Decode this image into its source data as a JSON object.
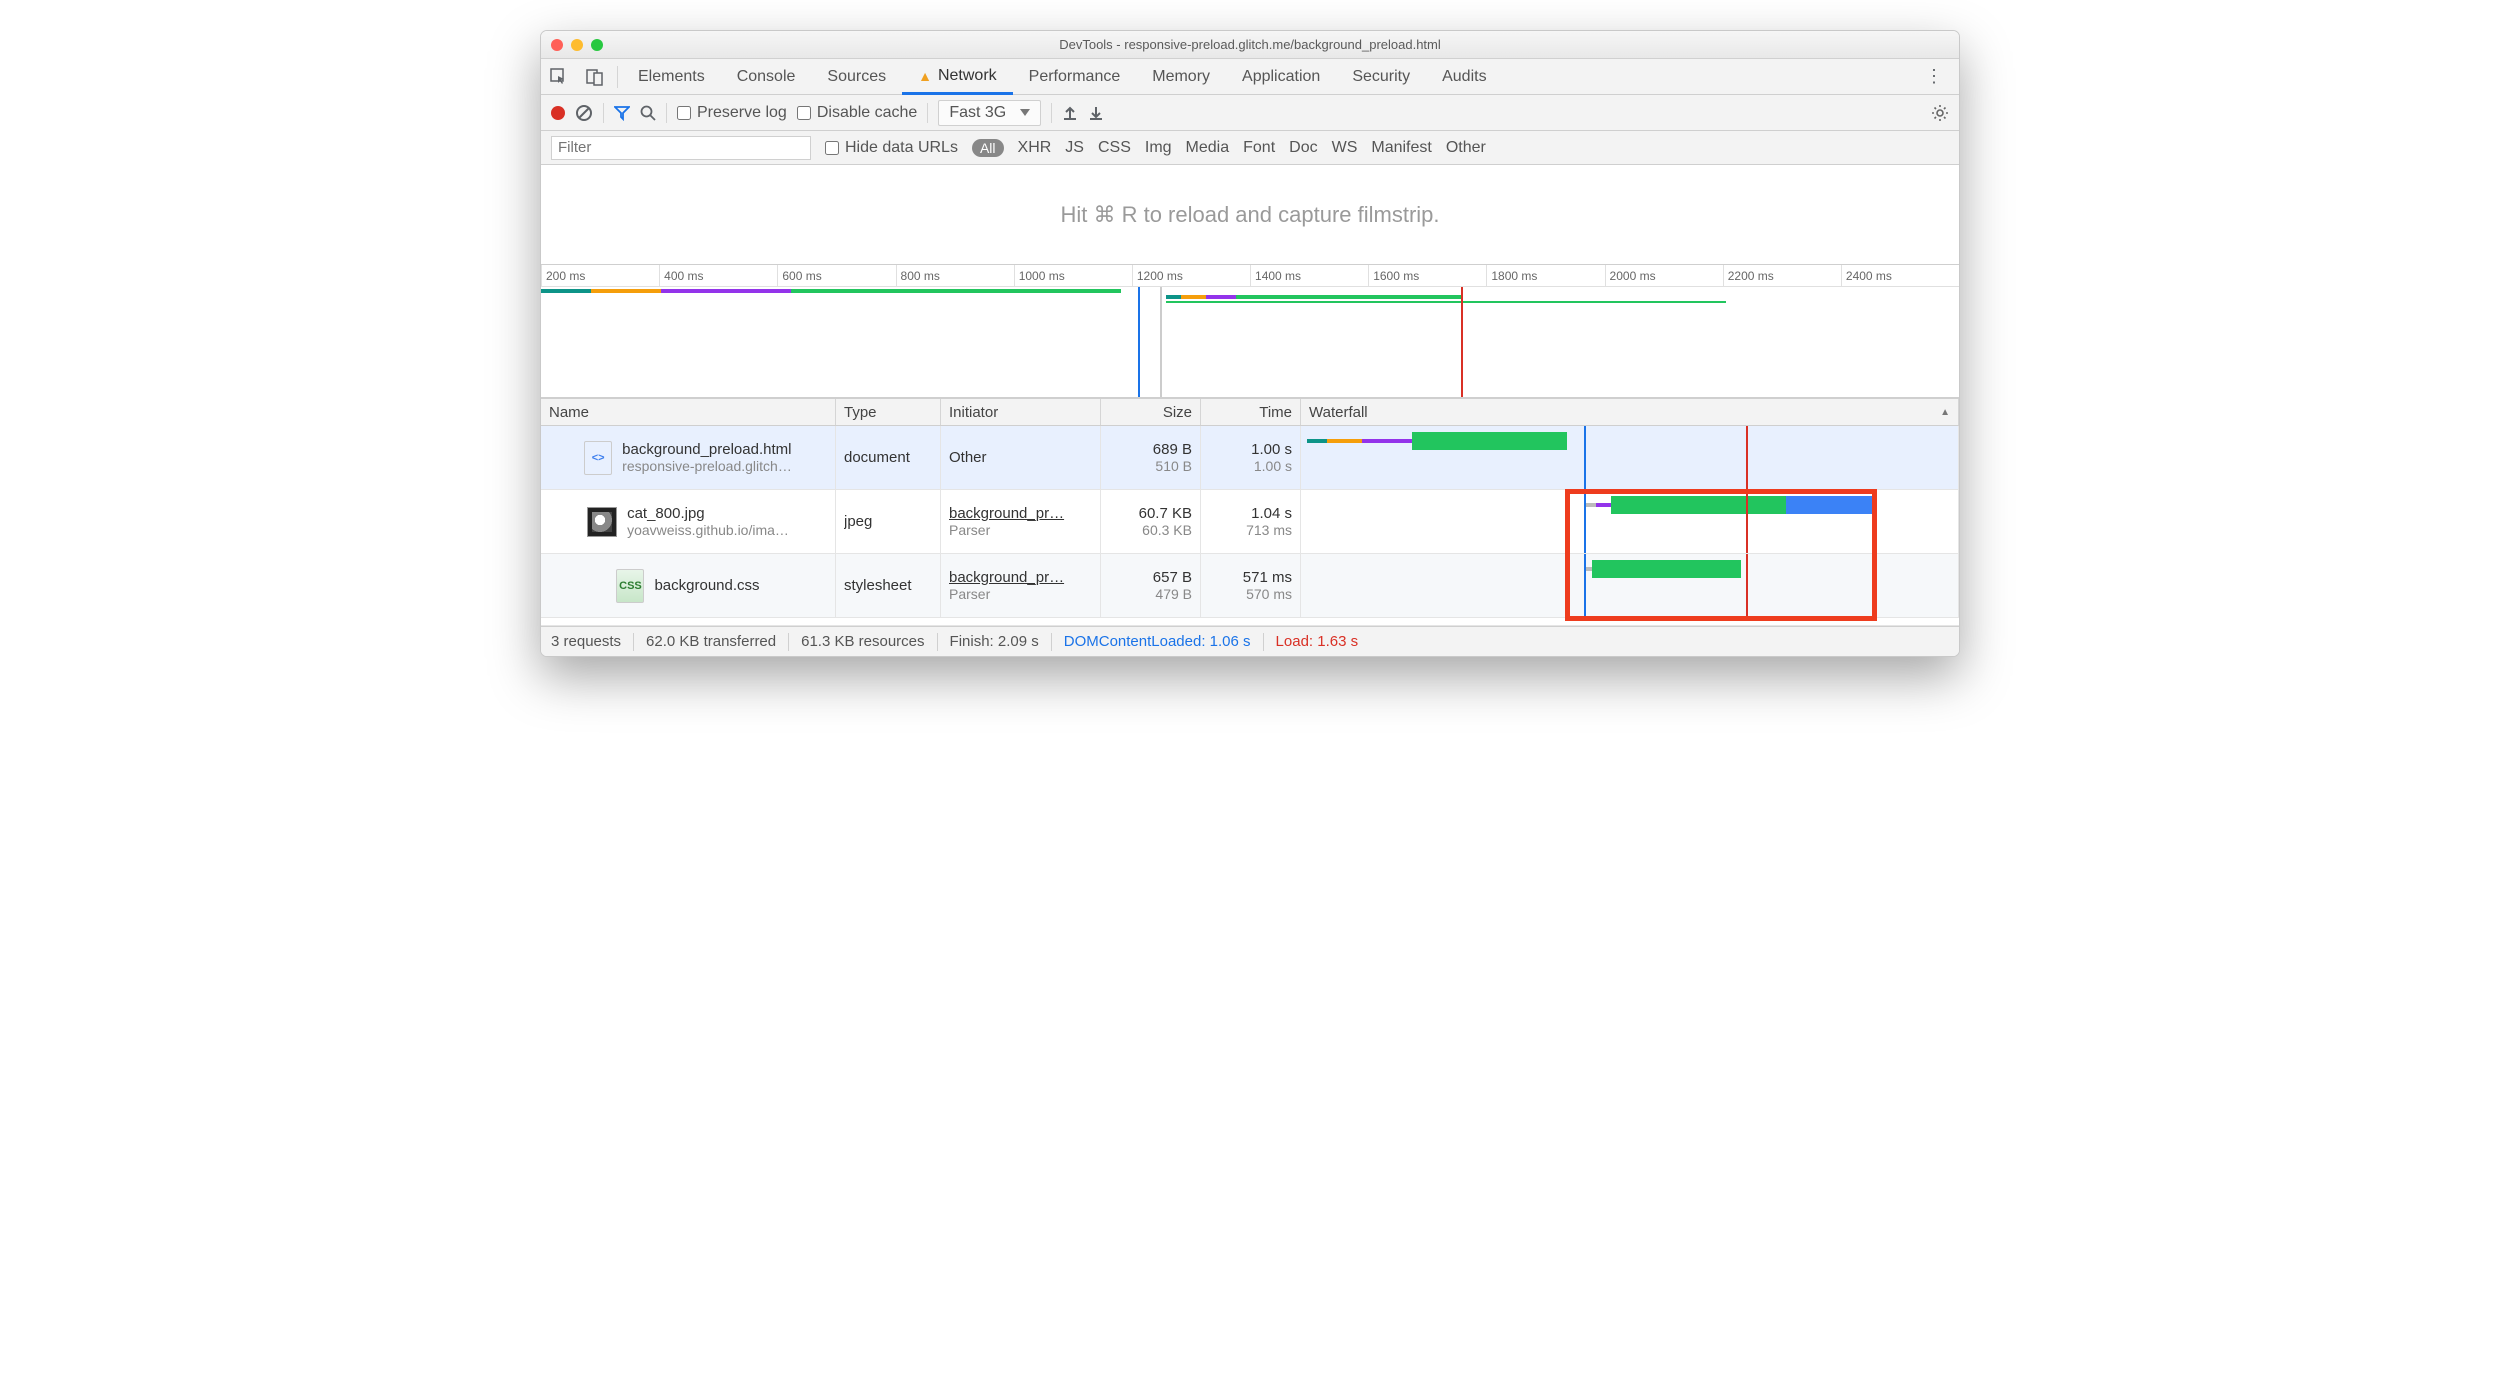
{
  "window": {
    "title": "DevTools - responsive-preload.glitch.me/background_preload.html"
  },
  "tabs": [
    "Elements",
    "Console",
    "Sources",
    "Network",
    "Performance",
    "Memory",
    "Application",
    "Security",
    "Audits"
  ],
  "activeTab": "Network",
  "toolbar": {
    "preserve": "Preserve log",
    "disable": "Disable cache",
    "throttle": "Fast 3G"
  },
  "filterbar": {
    "placeholder": "Filter",
    "hide": "Hide data URLs",
    "all": "All",
    "types": [
      "XHR",
      "JS",
      "CSS",
      "Img",
      "Media",
      "Font",
      "Doc",
      "WS",
      "Manifest",
      "Other"
    ]
  },
  "filmstrip": "Hit ⌘ R to reload and capture filmstrip.",
  "ruler": [
    "200 ms",
    "400 ms",
    "600 ms",
    "800 ms",
    "1000 ms",
    "1200 ms",
    "1400 ms",
    "1600 ms",
    "1800 ms",
    "2000 ms",
    "2200 ms",
    "2400 ms"
  ],
  "columns": {
    "name": "Name",
    "type": "Type",
    "initiator": "Initiator",
    "size": "Size",
    "time": "Time",
    "waterfall": "Waterfall"
  },
  "rows": [
    {
      "name": "background_preload.html",
      "sub": "responsive-preload.glitch…",
      "type": "document",
      "init": "Other",
      "initSub": "",
      "s1": "689 B",
      "s2": "510 B",
      "t1": "1.00 s",
      "t2": "1.00 s"
    },
    {
      "name": "cat_800.jpg",
      "sub": "yoavweiss.github.io/ima…",
      "type": "jpeg",
      "init": "background_pr…",
      "initSub": "Parser",
      "s1": "60.7 KB",
      "s2": "60.3 KB",
      "t1": "1.04 s",
      "t2": "713 ms"
    },
    {
      "name": "background.css",
      "sub": "",
      "type": "stylesheet",
      "init": "background_pr…",
      "initSub": "Parser",
      "s1": "657 B",
      "s2": "479 B",
      "t1": "571 ms",
      "t2": "570 ms"
    }
  ],
  "status": {
    "requests": "3 requests",
    "transferred": "62.0 KB transferred",
    "resources": "61.3 KB resources",
    "finish": "Finish: 2.09 s",
    "dcl": "DOMContentLoaded: 1.06 s",
    "load": "Load: 1.63 s"
  }
}
